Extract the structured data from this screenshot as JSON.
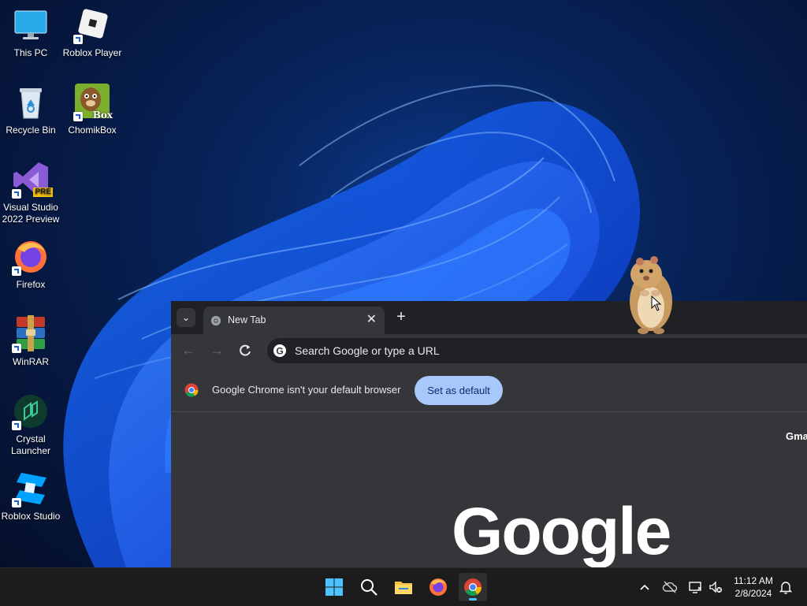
{
  "desktop": {
    "icons": [
      {
        "label": "This PC"
      },
      {
        "label": "Roblox Player"
      },
      {
        "label": "Recycle Bin"
      },
      {
        "label": "ChomikBox"
      },
      {
        "label": "Visual Studio 2022 Preview"
      },
      {
        "label": "Firefox"
      },
      {
        "label": "WinRAR"
      },
      {
        "label": "Crystal Launcher"
      },
      {
        "label": "Roblox Studio"
      }
    ],
    "badges": {
      "vs_pre": "PRE",
      "chomik_box": "Box"
    }
  },
  "chrome": {
    "tab": {
      "title": "New Tab",
      "close_glyph": "✕"
    },
    "new_tab_glyph": "+",
    "tab_search_glyph": "⌄",
    "omnibox": {
      "placeholder": "Search Google or type a URL"
    },
    "infobar": {
      "message": "Google Chrome isn't your default browser",
      "button_label": "Set as default"
    },
    "content": {
      "gmail_link": "Gmail",
      "logo_text": "Google"
    }
  },
  "taskbar": {
    "clock": {
      "time": "11:12 AM",
      "date": "2/8/2024"
    },
    "active_app": "chrome"
  },
  "colors": {
    "accent": "#4cc2ff",
    "chrome_bg": "#35363a",
    "chrome_tabstrip": "#202124",
    "set_default_button": "#a8c7fa"
  }
}
